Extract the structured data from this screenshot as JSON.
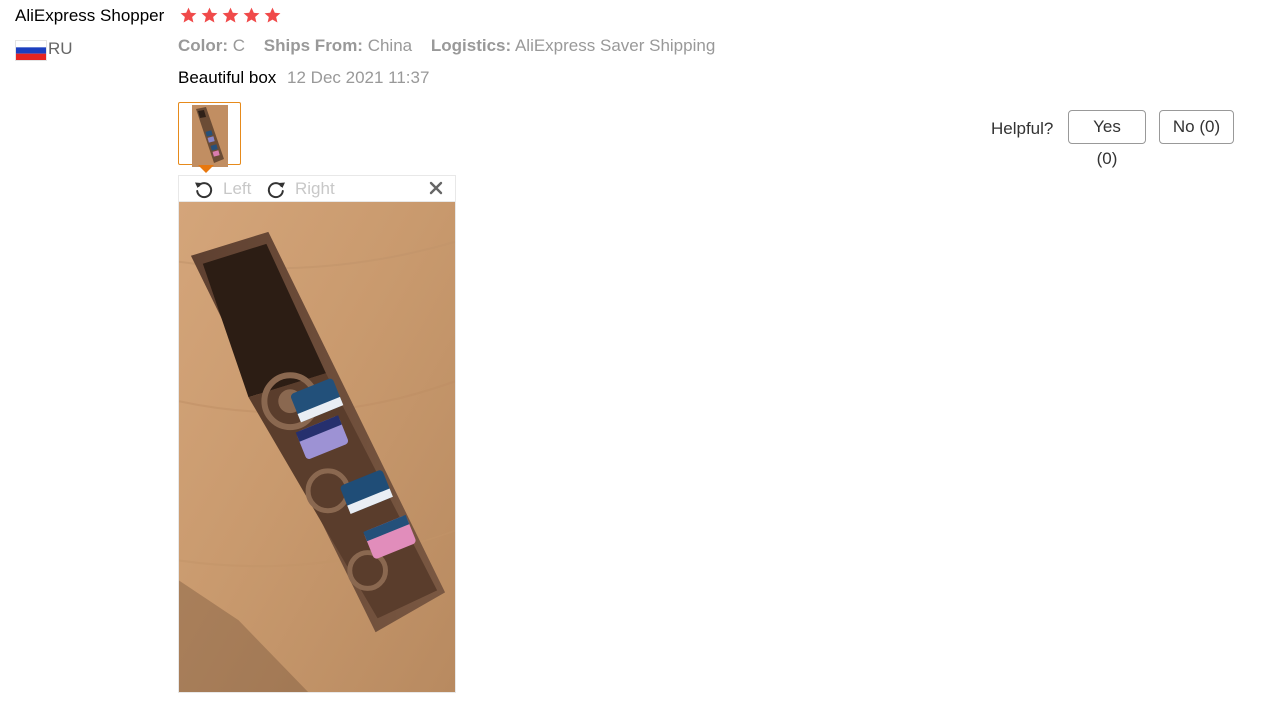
{
  "review": {
    "author_name": "AliExpress Shopper",
    "rating": 5,
    "rating_max": 5,
    "star_color": "#f04a4a",
    "country_code": "RU",
    "attributes": [
      {
        "key": "Color:",
        "value": "C"
      },
      {
        "key": "Ships From:",
        "value": "China"
      },
      {
        "key": "Logistics:",
        "value": "AliExpress Saver Shipping"
      }
    ],
    "text": "Beautiful box",
    "date": "12 Dec 2021 11:37"
  },
  "viewer": {
    "rotate_left_label": "Left",
    "rotate_right_label": "Right",
    "accent_color": "#e68a1b"
  },
  "feedback": {
    "question": "Helpful?",
    "yes_label": "Yes (0)",
    "no_label": "No (0)"
  }
}
